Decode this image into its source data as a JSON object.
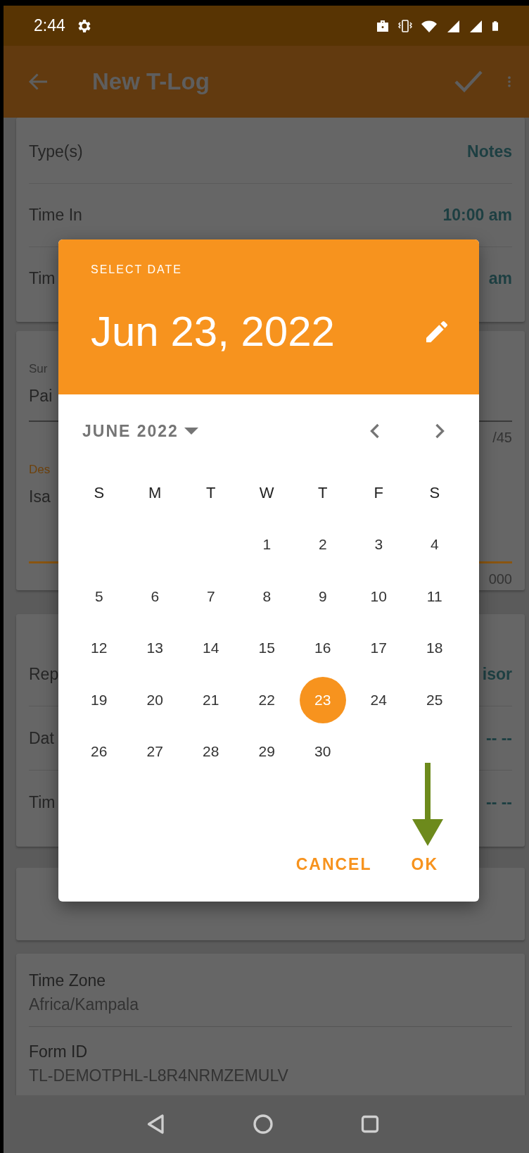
{
  "status_bar": {
    "time": "2:44"
  },
  "app_bar": {
    "title": "New T-Log"
  },
  "cards": [
    {
      "kind": "list",
      "rows": [
        {
          "label": "Type(s)",
          "value": "Notes"
        },
        {
          "label": "Time In",
          "value": "10:00 am"
        },
        {
          "label": "Tim",
          "value": "am"
        }
      ]
    },
    {
      "kind": "fields",
      "fields": [
        {
          "label": "Sur",
          "value": "Pai",
          "counter": "/45",
          "focused": false
        },
        {
          "label": "Des",
          "value": "Isa",
          "counter": "000",
          "focused": true
        }
      ]
    },
    {
      "kind": "list",
      "rows": [
        {
          "label": "Rep",
          "value": "isor"
        },
        {
          "label": "Dat",
          "value": "-- --"
        },
        {
          "label": "Tim",
          "value": "-- --"
        }
      ]
    },
    {
      "kind": "empty"
    },
    {
      "kind": "info",
      "rows": [
        {
          "label": "Time Zone",
          "value": "Africa/Kampala"
        },
        {
          "label": "Form ID",
          "value": "TL-DEMOTPHL-L8R4NRMZEMULV"
        }
      ]
    }
  ],
  "dialog": {
    "header_label": "SELECT DATE",
    "selected_date": "Jun 23, 2022",
    "month_label": "JUNE 2022",
    "weekdays": [
      "S",
      "M",
      "T",
      "W",
      "T",
      "F",
      "S"
    ],
    "weeks": [
      [
        {
          "kind": "blank"
        },
        {
          "kind": "blank"
        },
        {
          "kind": "blank"
        },
        {
          "kind": "day",
          "day": "1",
          "selected": false
        },
        {
          "kind": "day",
          "day": "2",
          "selected": false
        },
        {
          "kind": "day",
          "day": "3",
          "selected": false
        },
        {
          "kind": "day",
          "day": "4",
          "selected": false
        }
      ],
      [
        {
          "kind": "day",
          "day": "5",
          "selected": false
        },
        {
          "kind": "day",
          "day": "6",
          "selected": false
        },
        {
          "kind": "day",
          "day": "7",
          "selected": false
        },
        {
          "kind": "day",
          "day": "8",
          "selected": false
        },
        {
          "kind": "day",
          "day": "9",
          "selected": false
        },
        {
          "kind": "day",
          "day": "10",
          "selected": false
        },
        {
          "kind": "day",
          "day": "11",
          "selected": false
        }
      ],
      [
        {
          "kind": "day",
          "day": "12",
          "selected": false
        },
        {
          "kind": "day",
          "day": "13",
          "selected": false
        },
        {
          "kind": "day",
          "day": "14",
          "selected": false
        },
        {
          "kind": "day",
          "day": "15",
          "selected": false
        },
        {
          "kind": "day",
          "day": "16",
          "selected": false
        },
        {
          "kind": "day",
          "day": "17",
          "selected": false
        },
        {
          "kind": "day",
          "day": "18",
          "selected": false
        }
      ],
      [
        {
          "kind": "day",
          "day": "19",
          "selected": false
        },
        {
          "kind": "day",
          "day": "20",
          "selected": false
        },
        {
          "kind": "day",
          "day": "21",
          "selected": false
        },
        {
          "kind": "day",
          "day": "22",
          "selected": false
        },
        {
          "kind": "day",
          "day": "23",
          "selected": true
        },
        {
          "kind": "day",
          "day": "24",
          "selected": false
        },
        {
          "kind": "day",
          "day": "25",
          "selected": false
        }
      ],
      [
        {
          "kind": "day",
          "day": "26",
          "selected": false
        },
        {
          "kind": "day",
          "day": "27",
          "selected": false
        },
        {
          "kind": "day",
          "day": "28",
          "selected": false
        },
        {
          "kind": "day",
          "day": "29",
          "selected": false
        },
        {
          "kind": "day",
          "day": "30",
          "selected": false
        }
      ]
    ],
    "buttons": [
      {
        "label": "CANCEL"
      },
      {
        "label": "OK"
      }
    ]
  }
}
